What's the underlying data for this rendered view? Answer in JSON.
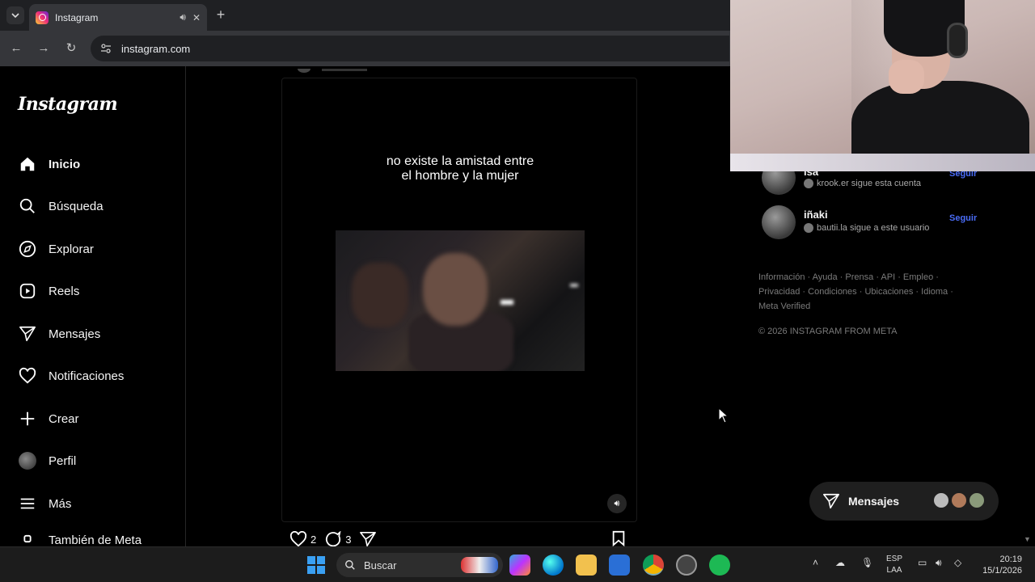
{
  "browser": {
    "tab_title": "Instagram",
    "url": "instagram.com"
  },
  "sidebar": {
    "logo": "Instagram",
    "items": [
      {
        "label": "Inicio",
        "icon": "home-icon"
      },
      {
        "label": "Búsqueda",
        "icon": "search-icon"
      },
      {
        "label": "Explorar",
        "icon": "compass-icon"
      },
      {
        "label": "Reels",
        "icon": "reels-icon"
      },
      {
        "label": "Mensajes",
        "icon": "send-icon"
      },
      {
        "label": "Notificaciones",
        "icon": "heart-icon"
      },
      {
        "label": "Crear",
        "icon": "plus-icon"
      },
      {
        "label": "Perfil",
        "icon": "avatar"
      },
      {
        "label": "Más",
        "icon": "menu-icon"
      },
      {
        "label": "También de Meta",
        "icon": "meta-icon"
      }
    ]
  },
  "post": {
    "caption_line1": "no existe la amistad entre",
    "caption_line2": "el hombre y la mujer",
    "likes": "2",
    "comments": "3"
  },
  "suggestions": [
    {
      "name": "isa",
      "subtitle": "krook.er sigue esta cuenta",
      "action": "Seguir"
    },
    {
      "name": "iñaki",
      "subtitle": "bautii.la sigue a este usuario",
      "action": "Seguir"
    }
  ],
  "footer": {
    "links_line1": "Información · Ayuda · Prensa · API · Empleo ·",
    "links_line2": "Privacidad · Condiciones · Ubicaciones · Idioma ·",
    "links_line3": "Meta Verified",
    "copyright": "© 2026 INSTAGRAM FROM META"
  },
  "messages_pill": {
    "label": "Mensajes"
  },
  "taskbar": {
    "search_placeholder": "Buscar",
    "lang_line1": "ESP",
    "lang_line2": "LAA",
    "time": "20:19",
    "date": "15/1/2026"
  },
  "colors": {
    "accent_link": "#4a6cf7",
    "background": "#000000",
    "browser_toolbar": "#35363a"
  }
}
